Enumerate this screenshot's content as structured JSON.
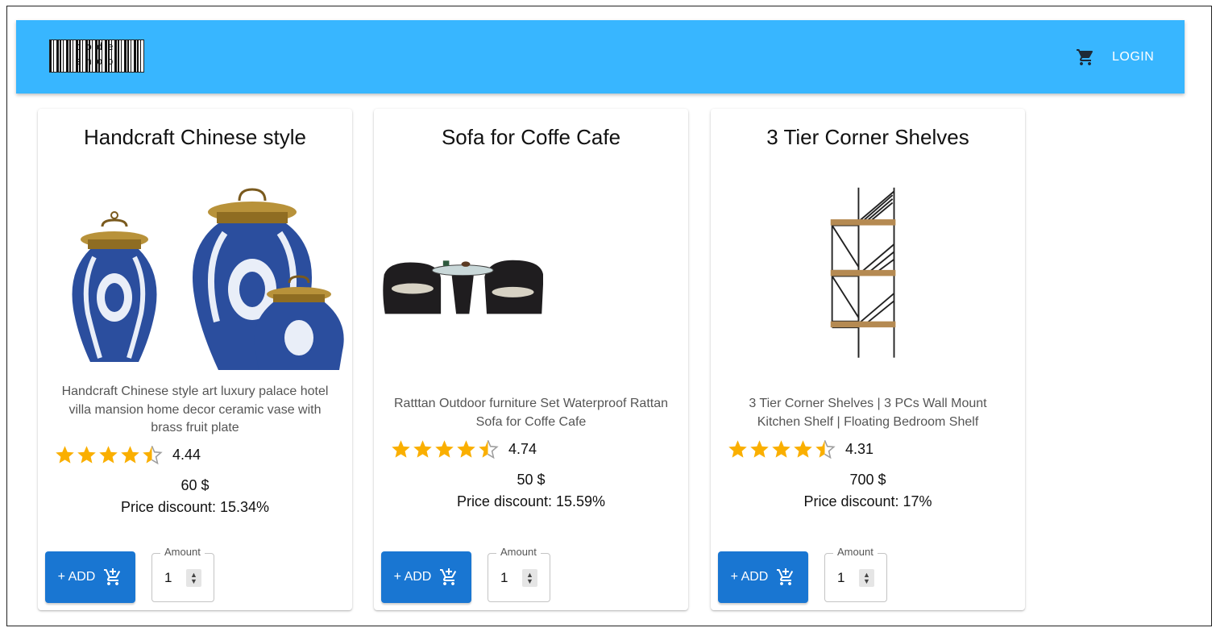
{
  "header": {
    "logo_line1": "code",
    "logo_line2": "shop",
    "cart_icon": "cart-icon",
    "login_label": "LOGIN",
    "bar_color": "#38b6ff"
  },
  "products": [
    {
      "title": "Handcraft Chinese style",
      "description": "Handcraft Chinese style art luxury palace hotel villa mansion home decor ceramic vase with brass fruit plate",
      "rating": "4.44",
      "price": "60 $",
      "discount": "Price discount: 15.34%",
      "add_label": "+ ADD",
      "amount_label": "Amount",
      "amount_value": "1"
    },
    {
      "title": "Sofa for Coffe Cafe",
      "description": "Ratttan Outdoor furniture Set Waterproof Rattan Sofa for Coffe Cafe",
      "rating": "4.74",
      "price": "50 $",
      "discount": "Price discount: 15.59%",
      "add_label": "+ ADD",
      "amount_label": "Amount",
      "amount_value": "1"
    },
    {
      "title": "3 Tier Corner Shelves",
      "description": "3 Tier Corner Shelves | 3 PCs Wall Mount Kitchen Shelf | Floating Bedroom Shelf",
      "rating": "4.31",
      "price": "700 $",
      "discount": "Price discount: 17%",
      "add_label": "+ ADD",
      "amount_label": "Amount",
      "amount_value": "1"
    }
  ],
  "colors": {
    "button": "#1976d2",
    "star": "#faaf00"
  }
}
